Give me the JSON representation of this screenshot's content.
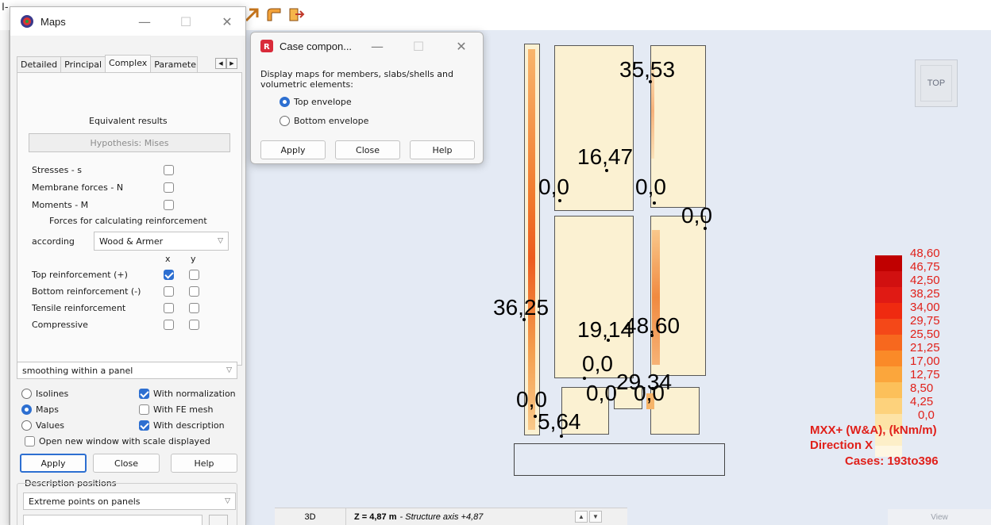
{
  "maps_window": {
    "title": "Maps",
    "tabs": [
      "Detailed",
      "Principal",
      "Complex",
      "Parameter"
    ],
    "selected_tab": "Complex",
    "equivalent_results": "Equivalent results",
    "hypothesis": "Hypothesis: Mises",
    "rows": [
      {
        "label": "Stresses - s",
        "checked": false
      },
      {
        "label": "Membrane forces - N",
        "checked": false
      },
      {
        "label": "Moments - M",
        "checked": false
      }
    ],
    "forces_heading": "Forces for calculating reinforcement",
    "according_label": "according",
    "according_value": "Wood & Armer",
    "col_x": "x",
    "col_y": "y",
    "reinforcement": [
      {
        "label": "Top reinforcement (+)",
        "x": true,
        "y": false
      },
      {
        "label": "Bottom reinforcement (-)",
        "x": false,
        "y": false
      },
      {
        "label": "Tensile reinforcement",
        "x": false,
        "y": false
      },
      {
        "label": "Compressive",
        "x": false,
        "y": false
      }
    ],
    "smoothing_value": "smoothing within a panel",
    "display_modes": [
      {
        "label": "Isolines",
        "selected": false
      },
      {
        "label": "Maps",
        "selected": true
      },
      {
        "label": "Values",
        "selected": false
      }
    ],
    "options": [
      {
        "label": "With normalization",
        "checked": true
      },
      {
        "label": "With FE mesh",
        "checked": false
      },
      {
        "label": "With description",
        "checked": true
      }
    ],
    "open_new_window": "Open new window with scale displayed",
    "apply": "Apply",
    "close": "Close",
    "help": "Help",
    "description_positions_title": "Description positions",
    "description_positions_value": "Extreme points on panels"
  },
  "case_window": {
    "title": "Case compon...",
    "text": "Display maps for members, slabs/shells and volumetric elements:",
    "options": [
      {
        "label": "Top envelope",
        "selected": true
      },
      {
        "label": "Bottom envelope",
        "selected": false
      }
    ],
    "apply": "Apply",
    "close": "Close",
    "help": "Help"
  },
  "viewport": {
    "labels": [
      "35,53",
      "16,47",
      "0,0",
      "0,0",
      "0,0",
      "36,25",
      "19,14",
      "48,60",
      "0,0",
      "29,34",
      "0,0",
      "0,0",
      "0,0",
      "5,64"
    ],
    "view_cube": "TOP"
  },
  "legend": {
    "values": [
      "48,60",
      "46,75",
      "42,50",
      "38,25",
      "34,00",
      "29,75",
      "25,50",
      "21,25",
      "17,00",
      "12,75",
      "8,50",
      "4,25",
      "0,0"
    ],
    "colors": [
      "#c00000",
      "#d11010",
      "#e01a14",
      "#ef2a10",
      "#f44818",
      "#f7681e",
      "#fa8a28",
      "#fba63c",
      "#fcc05a",
      "#fdd27c",
      "#fde3a6",
      "#fdefc8",
      "#fef7e2"
    ],
    "caption1": "MXX+ (W&A), (kNm/m)",
    "caption2": "Direction X",
    "caption3": "Cases: 193to396"
  },
  "statusbar": {
    "mode": "3D",
    "z_main": "Z = 4,87 m",
    "z_sub": "- Structure axis +4,87",
    "view": "View"
  },
  "ui_colors": {
    "accent": "#2d6fd1",
    "legend_text": "#e0201a",
    "panel_fill": "#fbf1d2"
  }
}
